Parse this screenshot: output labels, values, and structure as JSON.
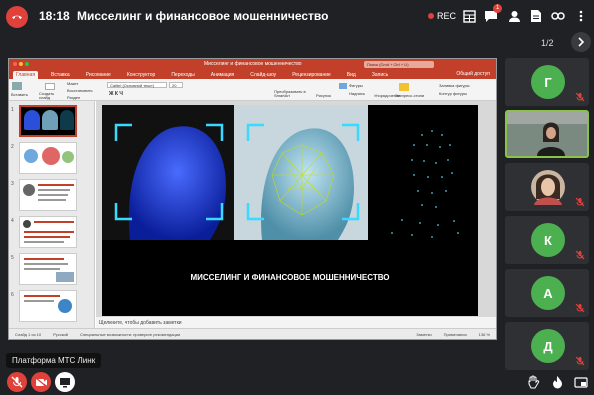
{
  "call": {
    "time": "18:18",
    "title": "Миссeлинг и финансовое мошенничество",
    "rec_label": "REC",
    "chat_badge": "1",
    "page_indicator": "1/2",
    "platform_label": "Платформа МТС Линк"
  },
  "colors": {
    "hangup": "#e0413a",
    "ppt_accent": "#c2402a",
    "avatar": "#4caf50",
    "active_border": "#8bc34a"
  },
  "ppt": {
    "doc_title": "Миссeлинг и финансовое мошенничество",
    "search_placeholder": "Поиск (Cmd + Ctrl + U)",
    "tabs": [
      "Главная",
      "Вставка",
      "Рисование",
      "Конструктор",
      "Переходы",
      "Анимация",
      "Слайд-шоу",
      "Рецензирование",
      "Вид",
      "Запись"
    ],
    "share": "Общий доступ",
    "ribbon": {
      "paste": "Вставить",
      "create_slide": "Создать слайд",
      "layout": "Макет",
      "restore": "Восстановить",
      "section": "Раздел",
      "font": "Calibri (Основной текст)",
      "font_size": "20",
      "convert_smartart": "Преобразовать в SmartArt",
      "picture": "Рисунок",
      "shapes": "Фигуры",
      "textbox": "Надпись",
      "arrange": "Упорядочение",
      "quick_styles": "Экспресс-стили",
      "shape_fill": "Заливка фигуры",
      "shape_outline": "Контур фигуры"
    },
    "slide_title": "МИССЕЛИНГ И ФИНАНСОВОЕ МОШЕННИЧЕСТВО",
    "notes_placeholder": "Щелкните, чтобы добавить заметки",
    "thumb_numbers": [
      "1",
      "2",
      "3",
      "4",
      "5",
      "6"
    ],
    "status": {
      "slide_of": "Слайд 1 из 10",
      "language": "Русский",
      "accessibility": "Специальные возможности: проверьте рекомендации",
      "notes": "Заметки",
      "comments": "Примечания",
      "zoom": "136 %"
    }
  },
  "participants": [
    {
      "initial": "Г",
      "type": "letter"
    },
    {
      "initial": "",
      "type": "video"
    },
    {
      "initial": "",
      "type": "photo"
    },
    {
      "initial": "К",
      "type": "letter"
    },
    {
      "initial": "А",
      "type": "letter"
    },
    {
      "initial": "Д",
      "type": "letter"
    }
  ]
}
